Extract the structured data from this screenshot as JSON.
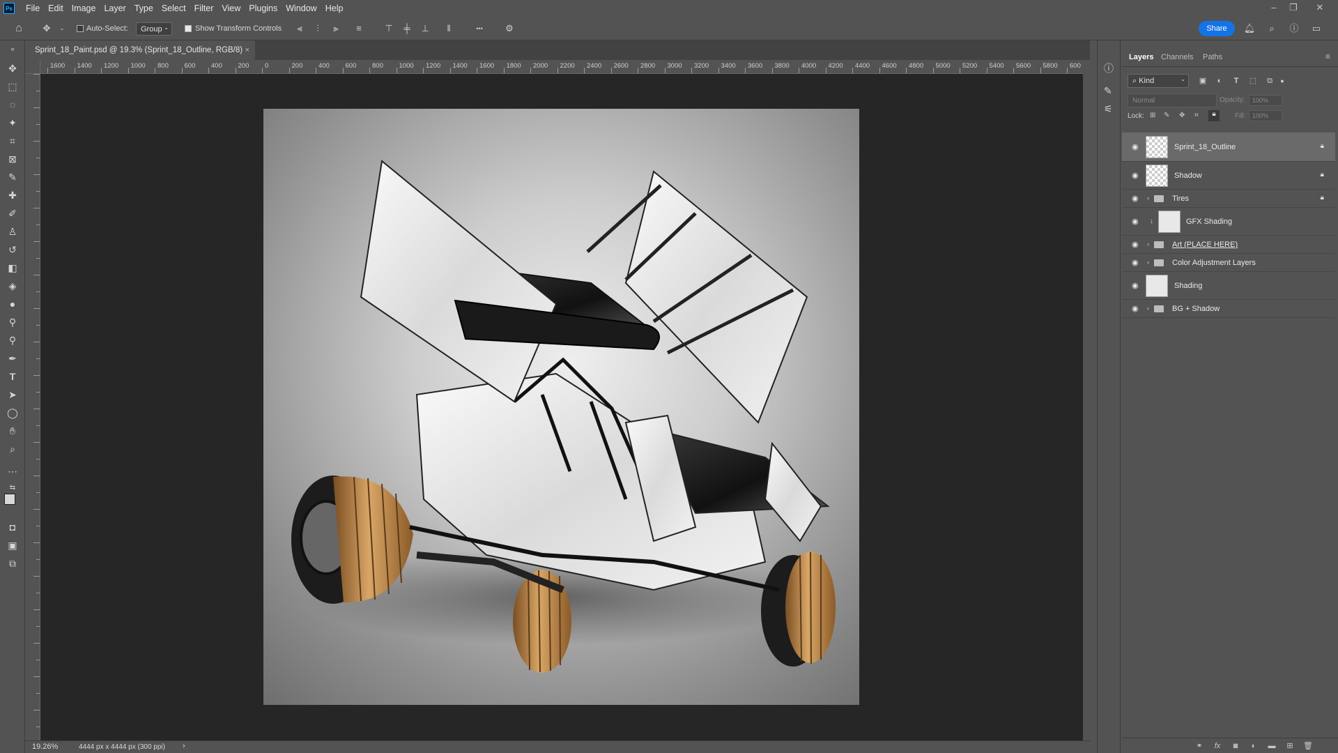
{
  "app": {
    "logo": "Ps"
  },
  "menu": [
    "File",
    "Edit",
    "Image",
    "Layer",
    "Type",
    "Select",
    "Filter",
    "View",
    "Plugins",
    "Window",
    "Help"
  ],
  "options": {
    "auto_select_label": "Auto-Select:",
    "auto_select_value": "Group",
    "show_transform_label": "Show Transform Controls",
    "more": "•••",
    "share_label": "Share"
  },
  "document": {
    "tab_title": "Sprint_18_Paint.psd @ 19.3% (Sprint_18_Outline, RGB/8)",
    "close": "×"
  },
  "ruler": {
    "h_labels": [
      "1600",
      "1400",
      "1200",
      "1000",
      "800",
      "600",
      "400",
      "200",
      "0",
      "200",
      "400",
      "600",
      "800",
      "1000",
      "1200",
      "1400",
      "1600",
      "1800",
      "2000",
      "2200",
      "2400",
      "2600",
      "2800",
      "3000",
      "3200",
      "3400",
      "3600",
      "3800",
      "4000",
      "4200",
      "4400",
      "4600",
      "4800",
      "5000",
      "5200",
      "5400",
      "5600",
      "5800",
      "600"
    ]
  },
  "status": {
    "zoom": "19.26%",
    "doc_info": "4444 px x 4444 px (300 ppi)",
    "arrow": "›"
  },
  "layers_panel": {
    "tabs": [
      "Layers",
      "Channels",
      "Paths"
    ],
    "active_tab": "Layers",
    "kind_label": "Kind",
    "blend_mode": "Normal",
    "opacity_label": "Opacity:",
    "opacity_value": "100%",
    "lock_label": "Lock:",
    "fill_label": "Fill:",
    "fill_value": "100%",
    "layers": [
      {
        "name": "Sprint_18_Outline",
        "type": "pixel",
        "locked": true,
        "selected": true
      },
      {
        "name": "Shadow",
        "type": "pixel",
        "locked": true,
        "selected": false
      },
      {
        "name": "Tires",
        "type": "group",
        "locked": true,
        "selected": false
      },
      {
        "name": "GFX Shading",
        "type": "pixel-clipped",
        "locked": false,
        "selected": false
      },
      {
        "name": "Art (PLACE HERE)",
        "type": "group",
        "locked": false,
        "selected": false
      },
      {
        "name": "Color Adjustment Layers",
        "type": "group",
        "locked": false,
        "selected": false
      },
      {
        "name": "Shading",
        "type": "pixel",
        "locked": false,
        "selected": false
      },
      {
        "name": "BG + Shadow",
        "type": "group",
        "locked": false,
        "selected": false
      }
    ]
  },
  "colors": {
    "ui_bg": "#535353",
    "canvas_bg": "#262626",
    "accent": "#1473e6",
    "tire_bronze": "#b07a3c"
  }
}
